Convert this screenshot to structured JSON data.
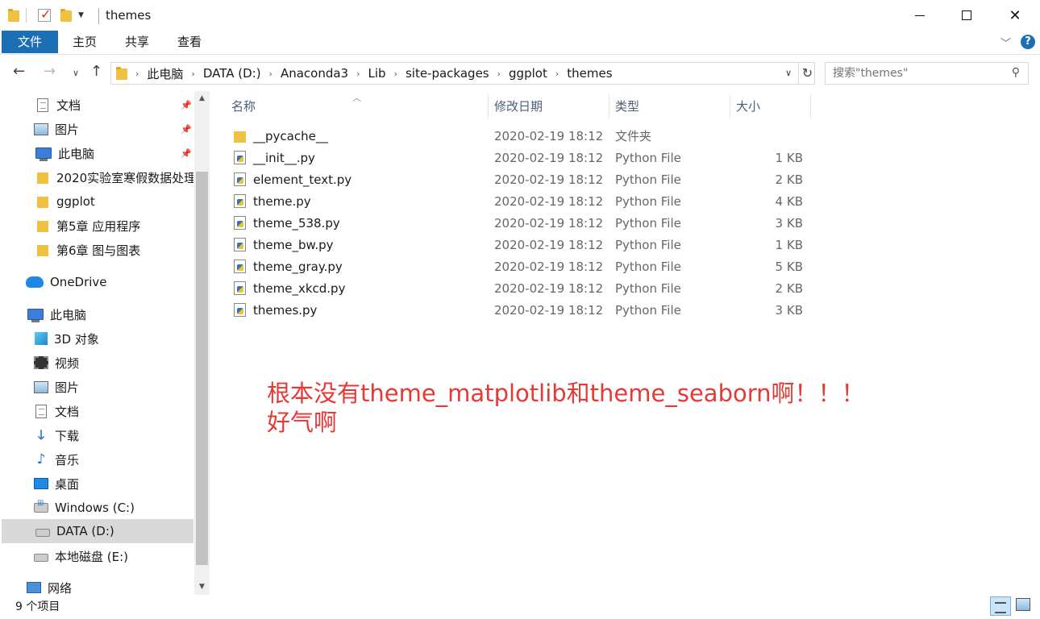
{
  "window": {
    "title": "themes"
  },
  "ribbon": {
    "tabs": [
      "文件",
      "主页",
      "共享",
      "查看"
    ]
  },
  "address": {
    "crumbs": [
      "此电脑",
      "DATA (D:)",
      "Anaconda3",
      "Lib",
      "site-packages",
      "ggplot",
      "themes"
    ]
  },
  "search": {
    "placeholder": "搜索\"themes\""
  },
  "sidebar": {
    "items": [
      {
        "label": "文档",
        "icon": "document-icon",
        "pinned": true
      },
      {
        "label": "图片",
        "icon": "picture-icon",
        "pinned": true
      },
      {
        "label": "此电脑",
        "icon": "computer-icon",
        "pinned": true
      },
      {
        "label": "2020实验室寒假数据处理",
        "icon": "folder-icon",
        "pinned": false
      },
      {
        "label": "ggplot",
        "icon": "folder-icon",
        "pinned": false
      },
      {
        "label": "第5章 应用程序",
        "icon": "folder-icon",
        "pinned": false
      },
      {
        "label": "第6章 图与图表",
        "icon": "folder-icon",
        "pinned": false
      },
      {
        "label": "OneDrive",
        "icon": "onedrive-icon",
        "pinned": false
      },
      {
        "label": "此电脑",
        "icon": "computer-icon",
        "pinned": false
      },
      {
        "label": "3D 对象",
        "icon": "3d-objects-icon",
        "pinned": false
      },
      {
        "label": "视频",
        "icon": "video-icon",
        "pinned": false
      },
      {
        "label": "图片",
        "icon": "picture-icon",
        "pinned": false
      },
      {
        "label": "文档",
        "icon": "document-icon",
        "pinned": false
      },
      {
        "label": "下载",
        "icon": "download-icon",
        "pinned": false
      },
      {
        "label": "音乐",
        "icon": "music-icon",
        "pinned": false
      },
      {
        "label": "桌面",
        "icon": "desktop-icon",
        "pinned": false
      },
      {
        "label": "Windows (C:)",
        "icon": "windows-drive-icon",
        "pinned": false
      },
      {
        "label": "DATA (D:)",
        "icon": "drive-icon",
        "pinned": false,
        "selected": true
      },
      {
        "label": "本地磁盘 (E:)",
        "icon": "drive-icon",
        "pinned": false
      },
      {
        "label": "网络",
        "icon": "network-icon",
        "pinned": false
      }
    ]
  },
  "columns": {
    "name": "名称",
    "date": "修改日期",
    "type": "类型",
    "size": "大小"
  },
  "files": [
    {
      "name": "__pycache__",
      "date": "2020-02-19 18:12",
      "type": "文件夹",
      "size": "",
      "kind": "folder"
    },
    {
      "name": "__init__.py",
      "date": "2020-02-19 18:12",
      "type": "Python File",
      "size": "1 KB",
      "kind": "py"
    },
    {
      "name": "element_text.py",
      "date": "2020-02-19 18:12",
      "type": "Python File",
      "size": "2 KB",
      "kind": "py"
    },
    {
      "name": "theme.py",
      "date": "2020-02-19 18:12",
      "type": "Python File",
      "size": "4 KB",
      "kind": "py"
    },
    {
      "name": "theme_538.py",
      "date": "2020-02-19 18:12",
      "type": "Python File",
      "size": "3 KB",
      "kind": "py"
    },
    {
      "name": "theme_bw.py",
      "date": "2020-02-19 18:12",
      "type": "Python File",
      "size": "1 KB",
      "kind": "py"
    },
    {
      "name": "theme_gray.py",
      "date": "2020-02-19 18:12",
      "type": "Python File",
      "size": "5 KB",
      "kind": "py"
    },
    {
      "name": "theme_xkcd.py",
      "date": "2020-02-19 18:12",
      "type": "Python File",
      "size": "2 KB",
      "kind": "py"
    },
    {
      "name": "themes.py",
      "date": "2020-02-19 18:12",
      "type": "Python File",
      "size": "3 KB",
      "kind": "py"
    }
  ],
  "annotation": {
    "line1": "根本没有theme_matplotlib和theme_seaborn啊！！！",
    "line2": "好气啊"
  },
  "status": {
    "count": "9 个项目"
  },
  "colors": {
    "accent": "#1c6fb5",
    "annotation": "#e53935",
    "selected": "#d9d9d9"
  }
}
